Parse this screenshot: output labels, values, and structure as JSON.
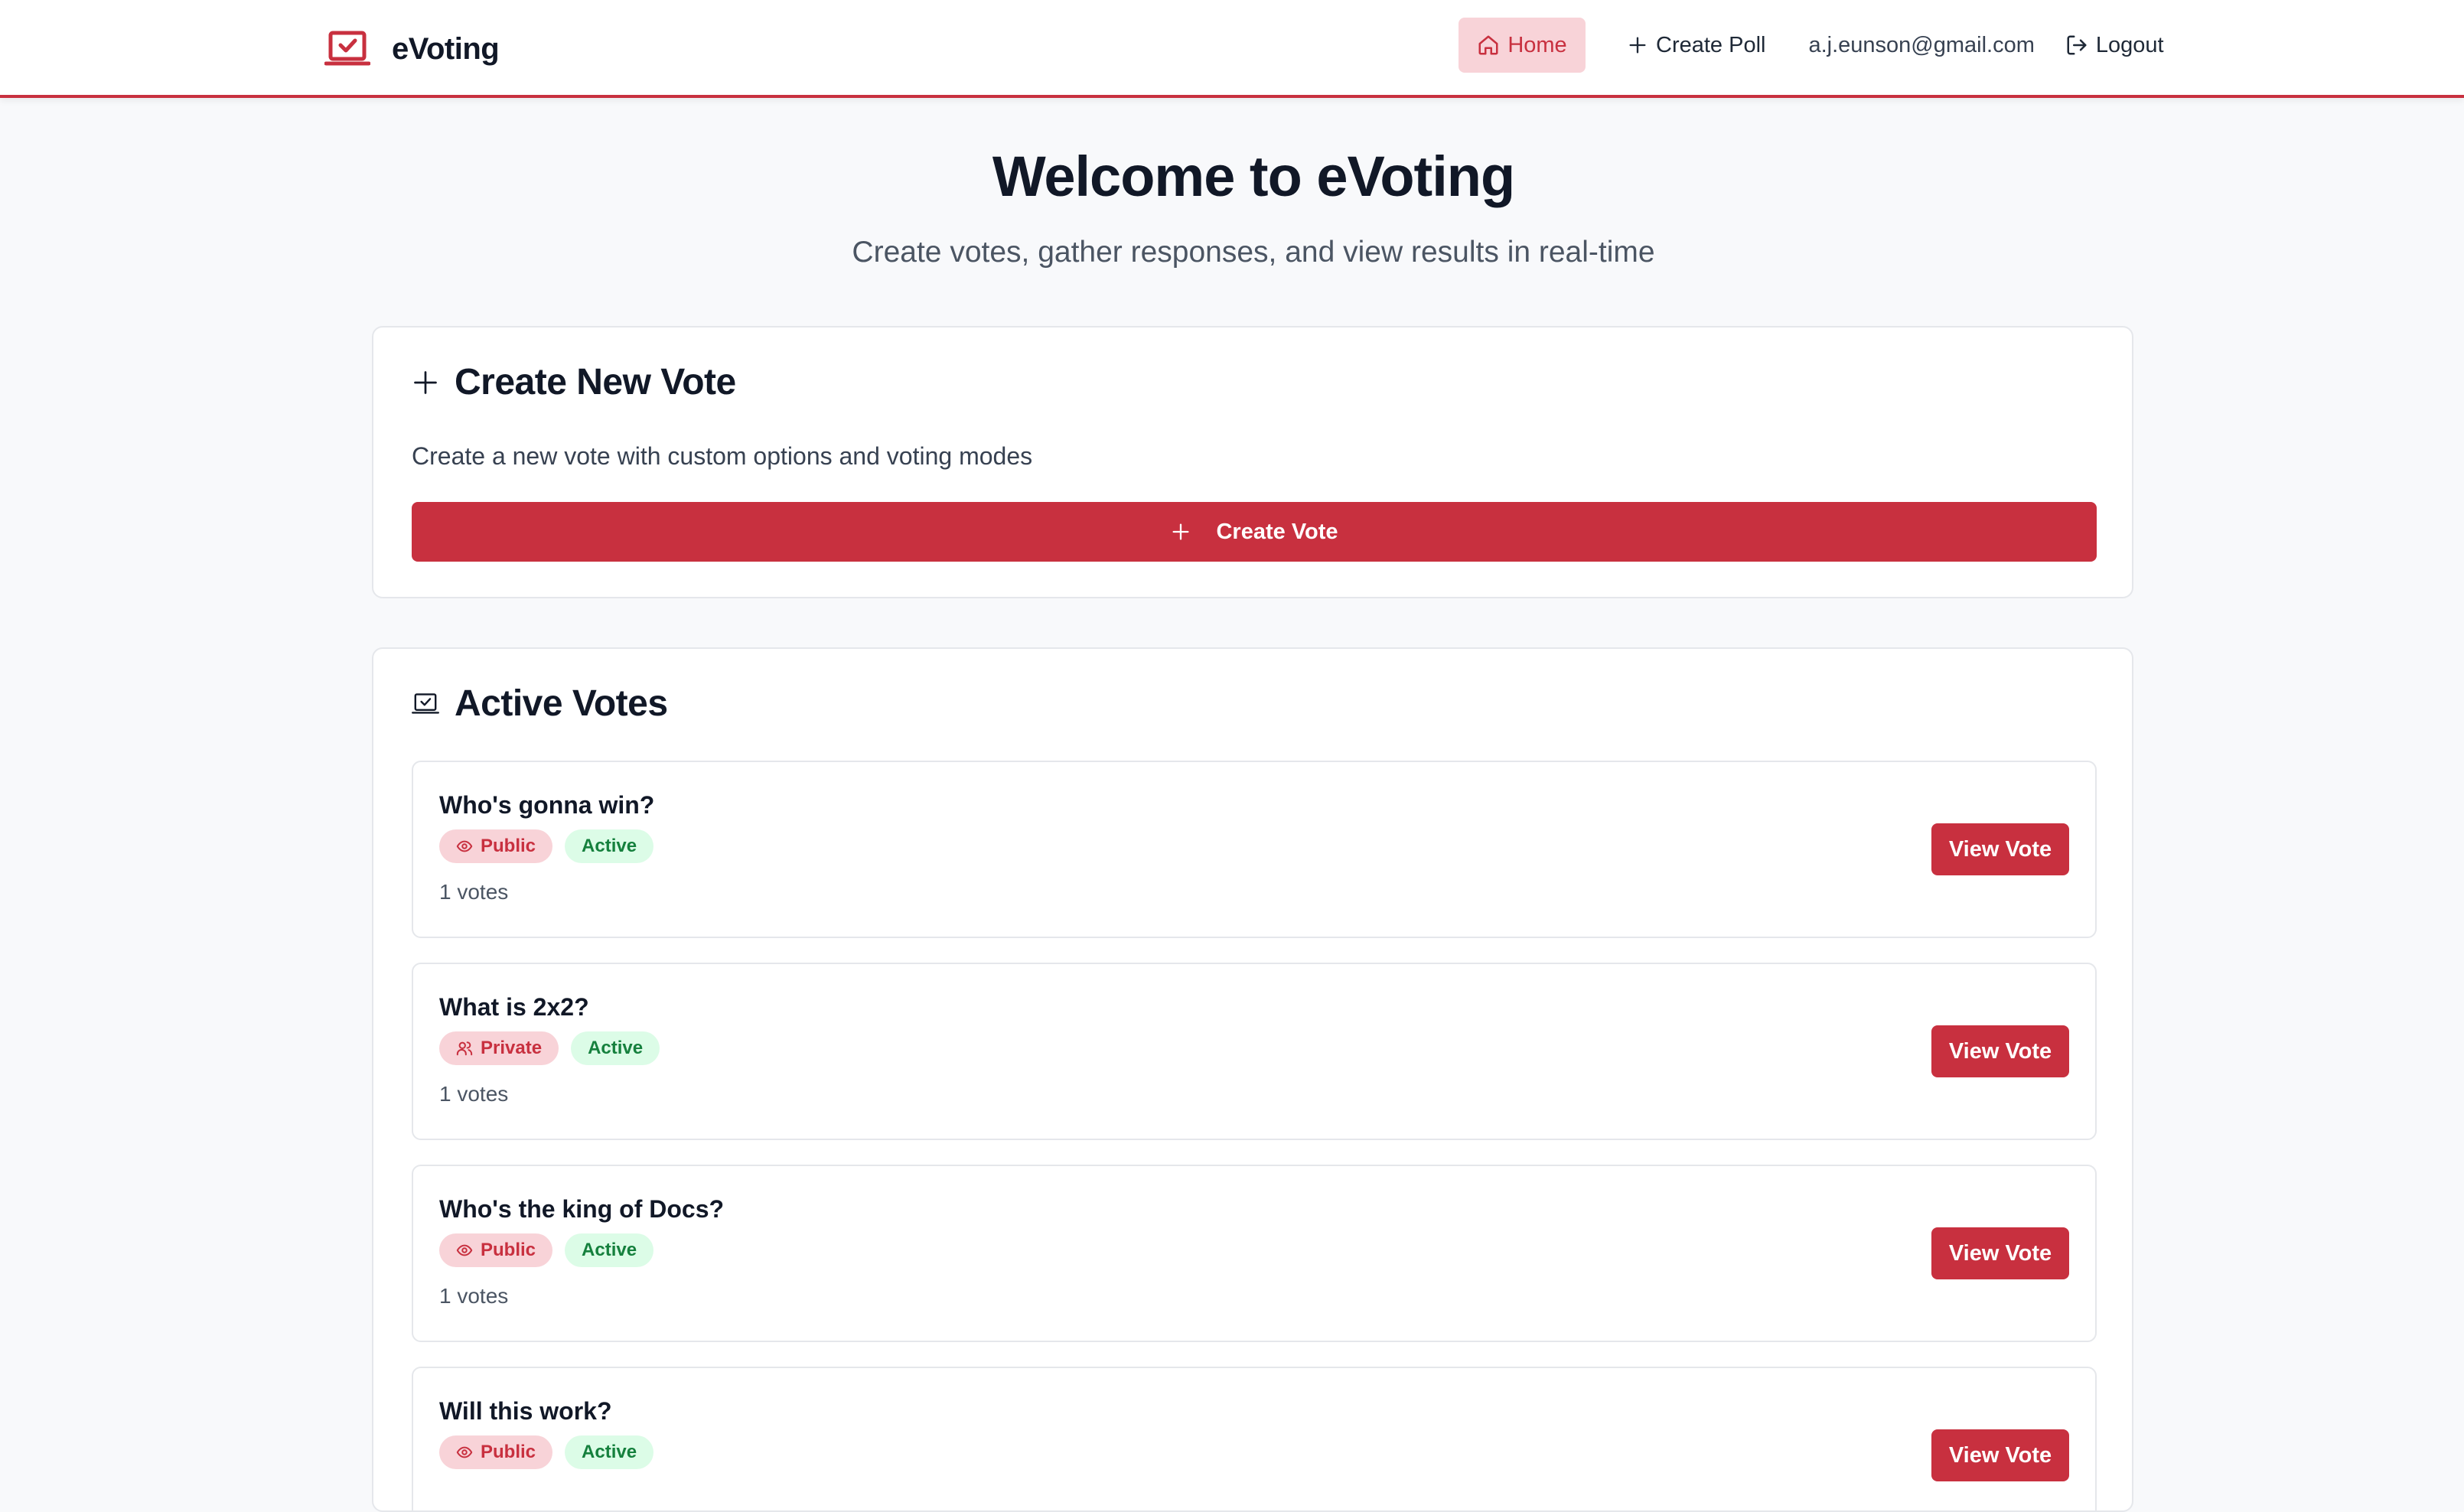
{
  "app": {
    "name": "eVoting",
    "logo_icon": "vote-laptop-check-icon",
    "accent_color": "#c8303f"
  },
  "nav": {
    "home_label": "Home",
    "home_icon": "home-icon",
    "create_poll_label": "Create Poll",
    "create_poll_icon": "plus-icon",
    "user_email": "a.j.eunson@gmail.com",
    "logout_label": "Logout",
    "logout_icon": "logout-icon"
  },
  "hero": {
    "title": "Welcome to eVoting",
    "subtitle": "Create votes, gather responses, and view results in real-time"
  },
  "create_card": {
    "title": "Create New Vote",
    "title_icon": "plus-icon",
    "description": "Create a new vote with custom options and voting modes",
    "button_label": "Create Vote",
    "button_icon": "plus-icon"
  },
  "active_votes": {
    "title": "Active Votes",
    "title_icon": "vote-laptop-check-icon",
    "view_button_label": "View Vote",
    "items": [
      {
        "title": "Who's gonna win?",
        "visibility": "Public",
        "visibility_icon": "eye-icon",
        "status": "Active",
        "votes": "1 votes"
      },
      {
        "title": "What is 2x2?",
        "visibility": "Private",
        "visibility_icon": "users-icon",
        "status": "Active",
        "votes": "1 votes"
      },
      {
        "title": "Who's the king of Docs?",
        "visibility": "Public",
        "visibility_icon": "eye-icon",
        "status": "Active",
        "votes": "1 votes"
      },
      {
        "title": "Will this work?",
        "visibility": "Public",
        "visibility_icon": "eye-icon",
        "status": "Active",
        "votes": ""
      }
    ]
  }
}
